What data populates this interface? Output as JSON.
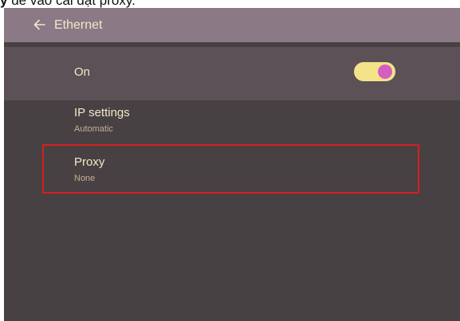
{
  "caption": {
    "bold": "y",
    "rest": " để vào cài đặt proxy."
  },
  "header": {
    "title": "Ethernet",
    "back_icon": "arrow-left-icon"
  },
  "ethernet_toggle": {
    "label": "On",
    "state": "on",
    "track_color": "#f5e38a",
    "knob_color": "#d55fc0"
  },
  "settings": {
    "ip": {
      "title": "IP settings",
      "value": "Automatic"
    },
    "proxy": {
      "title": "Proxy",
      "value": "None"
    }
  },
  "colors": {
    "titlebar": "#8c7986",
    "toggle_row": "#5b5156",
    "background": "#474144",
    "text": "#f1e8c8",
    "subtext": "#c8ae93",
    "highlight": "#d81e1e"
  }
}
